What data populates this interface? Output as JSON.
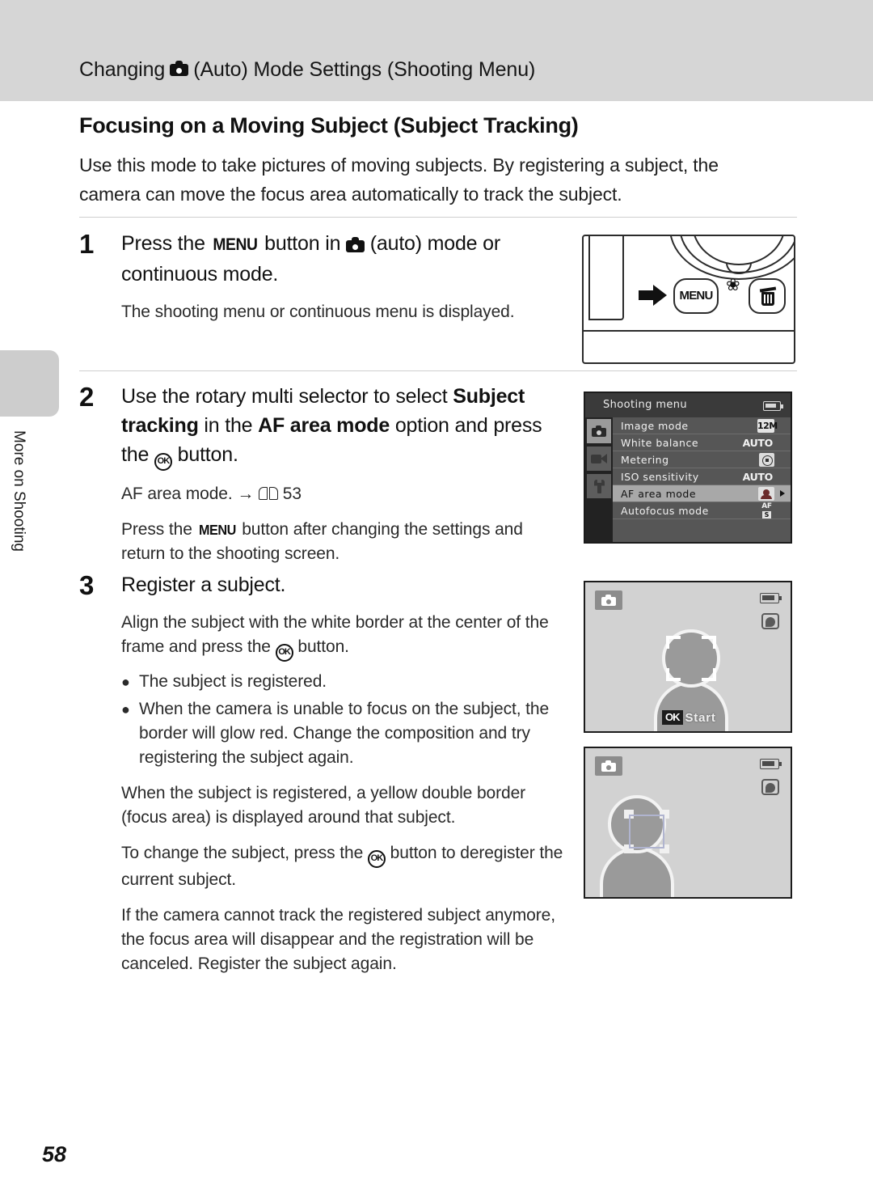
{
  "header": {
    "running_head_before": "Changing",
    "running_head_icon": "camera-auto-icon",
    "running_head_after": "(Auto) Mode Settings (Shooting Menu)"
  },
  "side_tab": {
    "label": "More on Shooting"
  },
  "section": {
    "title": "Focusing on a Moving Subject (Subject Tracking)",
    "intro": "Use this mode to take pictures of moving subjects. By registering a subject, the camera can move the focus area automatically to track the subject."
  },
  "steps": [
    {
      "number": "1",
      "head_part1": "Press the",
      "head_menu": "MENU",
      "head_part2": "button in",
      "head_part3": "(auto) mode or continuous mode.",
      "body": "The shooting menu or continuous menu is displayed."
    },
    {
      "number": "2",
      "head_part1": "Use the rotary multi selector to select",
      "head_bold1": "Subject tracking",
      "head_part2": "in the",
      "head_bold2": "AF area mode",
      "head_part3": "option and press the",
      "head_part4": "button.",
      "ref_label": "AF area mode.",
      "ref_arrow": "→",
      "ref_page": "53",
      "body1_part1": "Press the",
      "body1_menu": "MENU",
      "body1_part2": "button after changing the settings and return to the shooting screen."
    },
    {
      "number": "3",
      "head": "Register a subject.",
      "intro_part1": "Align the subject with the white border at the center of the frame and press the",
      "intro_part2": "button.",
      "bullets": [
        "The subject is registered.",
        "When the camera is unable to focus on the subject, the border will glow red. Change the composition and try registering the subject again."
      ],
      "para1": "When the subject is registered, a yellow double border (focus area) is displayed around that subject.",
      "para2_part1": "To change the subject, press the",
      "para2_part2": "button to deregister the current subject.",
      "para3": "If the camera cannot track the registered subject anymore, the focus area will disappear and the registration will be canceled. Register the subject again."
    }
  ],
  "figures": {
    "camera_back": {
      "menu_button_label": "MENU",
      "macro_icon": "macro-flower-icon",
      "delete_icon": "trash-can-icon",
      "arrow_icon": "right-arrow-icon"
    },
    "shooting_menu": {
      "title": "Shooting menu",
      "battery_icon": "battery-full-icon",
      "tabs": [
        {
          "icon": "camera-tab-icon",
          "selected": true
        },
        {
          "icon": "movie-tab-icon",
          "selected": false
        },
        {
          "icon": "wrench-setup-tab-icon",
          "selected": false
        }
      ],
      "rows": [
        {
          "label": "Image mode",
          "value": "12M",
          "value_type": "badge",
          "selected": false
        },
        {
          "label": "White balance",
          "value": "AUTO",
          "value_type": "text",
          "selected": false
        },
        {
          "label": "Metering",
          "value": "",
          "value_type": "metering",
          "selected": false
        },
        {
          "label": "ISO sensitivity",
          "value": "AUTO",
          "value_type": "text",
          "selected": false
        },
        {
          "label": "AF area mode",
          "value": "",
          "value_type": "tracking",
          "selected": true
        },
        {
          "label": "Autofocus mode",
          "value": "AF",
          "value_sub": "S",
          "value_type": "afs",
          "selected": false
        }
      ]
    },
    "lcd_register": {
      "mode_icon": "auto-mode-icon",
      "battery_icon": "battery-indicator-icon",
      "vr_icon": "vibration-reduction-icon",
      "focus_frame": "white-corner-focus-frame",
      "ok_badge": "OK",
      "ok_text": "Start"
    },
    "lcd_tracking": {
      "mode_icon": "auto-mode-icon",
      "battery_icon": "battery-indicator-icon",
      "vr_icon": "vibration-reduction-icon",
      "focus_frame": "yellow-double-tracking-border"
    }
  },
  "page_number": "58"
}
